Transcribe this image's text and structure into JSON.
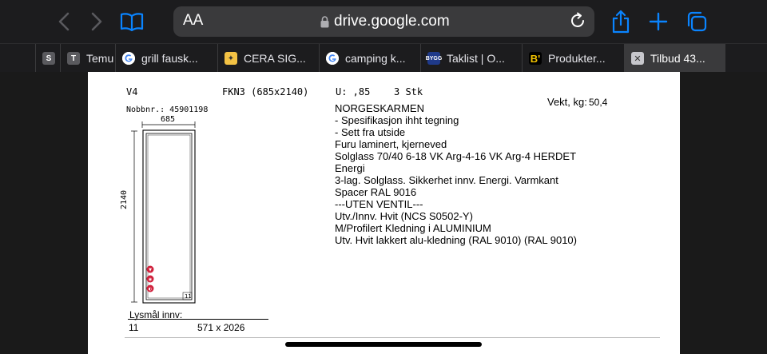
{
  "browser": {
    "aa_label": "AA",
    "url": "drive.google.com"
  },
  "tabs": [
    {
      "label": "S",
      "favicon": "none"
    },
    {
      "label": "Temu",
      "favicon": "letter",
      "letter": "T"
    },
    {
      "label": "grill fausk...",
      "favicon": "google"
    },
    {
      "label": "CERA SIG...",
      "favicon": "cera"
    },
    {
      "label": "camping k...",
      "favicon": "google"
    },
    {
      "label": "Taklist | O...",
      "favicon": "bygg",
      "letter": "Byggmakker"
    },
    {
      "label": "Produkter...",
      "favicon": "b",
      "letter": "B'"
    },
    {
      "label": "Tilbud 43...",
      "favicon": "close",
      "letter": "✕",
      "active": true
    }
  ],
  "document": {
    "position": "V4",
    "product_code": "FKN3 (685x2140)",
    "u_value": "U: ,85",
    "quantity": "3 Stk",
    "weight_label": "Vekt, kg:",
    "weight_value": "50,4",
    "nobb_label": "Nobbnr.: 45901198",
    "width_dim": "685",
    "height_dim": "2140",
    "corner_label": "11",
    "spec_lines": [
      "NORGESKARMEN",
      "- Spesifikasjon ihht tegning",
      "- Sett fra utside",
      "Furu laminert, kjerneved",
      "Solglass 70/40 6-18 VK Arg-4-16 VK Arg-4 HERDET",
      "Energi",
      "3-lag. Solglass. Sikkerhet innv. Energi. Varmkant",
      "Spacer RAL 9016",
      "---UTEN VENTIL---",
      "Utv./Innv. Hvit (NCS S0502-Y)",
      "M/Profilert Kledning i ALUMINIUM",
      "Utv. Hvit lakkert alu-kledning (RAL 9010) (RAL 9010)"
    ],
    "lysmal_label": "Lysmål innv:",
    "lysmal_number": "11",
    "lysmal_dims": "571 x 2026"
  },
  "colors": {
    "chrome_bg": "#1c1c1e",
    "address_bg": "#3a3a3c",
    "accent_blue": "#0a84ff",
    "badge_red": "#d0213c"
  },
  "icons": [
    "back-icon",
    "forward-icon",
    "book-icon",
    "lock-icon",
    "reload-icon",
    "share-icon",
    "plus-icon",
    "tabs-icon"
  ]
}
